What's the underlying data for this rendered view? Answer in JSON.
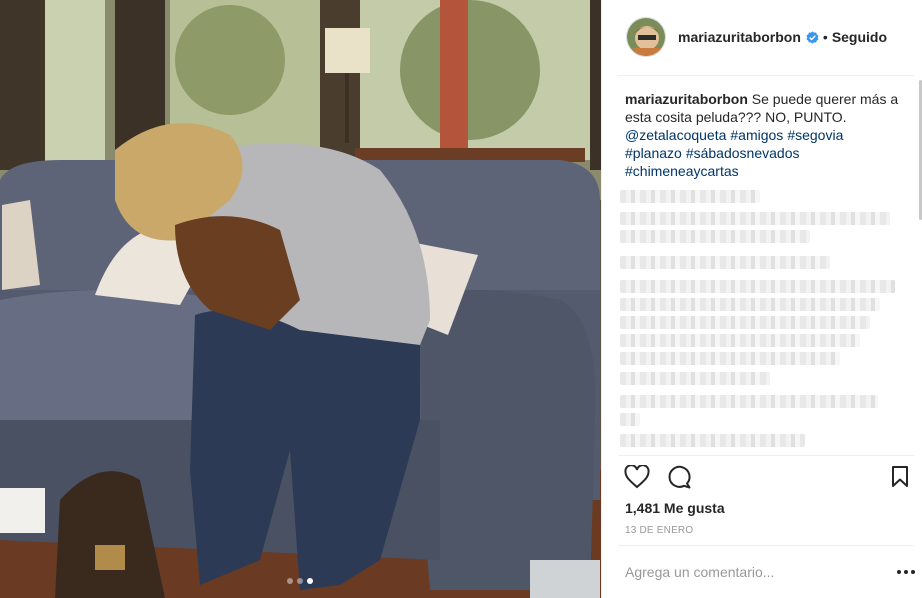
{
  "post": {
    "username": "mariazuritaborbon",
    "separator": "•",
    "follow_status": "Seguido",
    "caption_user": "mariazuritaborbon",
    "caption_text": "Se puede querer más a esta cosita peluda??? NO, PUNTO.",
    "hashtags": [
      "@zetalacoqueta",
      "#amigos",
      "#segovia",
      "#planazo",
      "#sábadosnevados",
      "#chimeneaycartas"
    ],
    "likes": "1,481 Me gusta",
    "date": "13 DE ENERO",
    "comment_placeholder": "Agrega un comentario...",
    "carousel": {
      "count": 3,
      "active": 3
    }
  },
  "icons": {
    "verified": "verified-badge-icon",
    "like": "heart-icon",
    "comment": "speech-bubble-icon",
    "save": "bookmark-icon",
    "more": "more-options-icon"
  },
  "colors": {
    "text": "#262626",
    "link": "#003569",
    "muted": "#999999",
    "verified": "#3897f0",
    "border": "#efefef"
  }
}
